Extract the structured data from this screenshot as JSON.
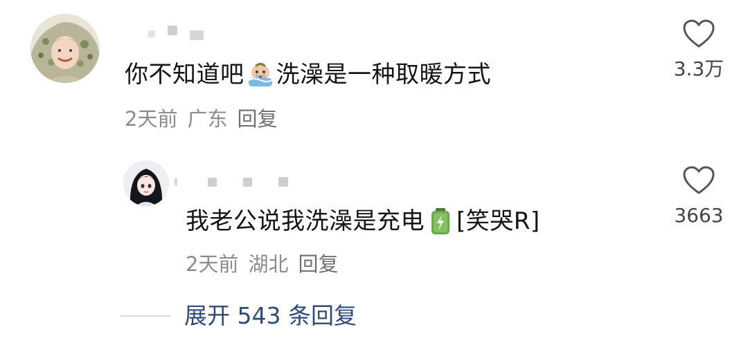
{
  "comments": [
    {
      "text_before_emoji": "你不知道吧",
      "text_after_emoji": "洗澡是一种取暖方式",
      "emoji_icon": "crying-in-bath-emoji",
      "time": "2天前",
      "region": "广东",
      "reply_label": "回复",
      "like_count": "3.3万"
    },
    {
      "text_before_emoji": "我老公说我洗澡是充电",
      "text_after_emoji": "[笑哭R]",
      "emoji_icon": "battery-charging-emoji",
      "time": "2天前",
      "region": "湖北",
      "reply_label": "回复",
      "like_count": "3663"
    }
  ],
  "expand_replies_label": "展开 543 条回复",
  "colors": {
    "meta_gray": "#8c8c8c",
    "expand_link": "#2e4a78",
    "battery_green": "#6aa84f"
  }
}
